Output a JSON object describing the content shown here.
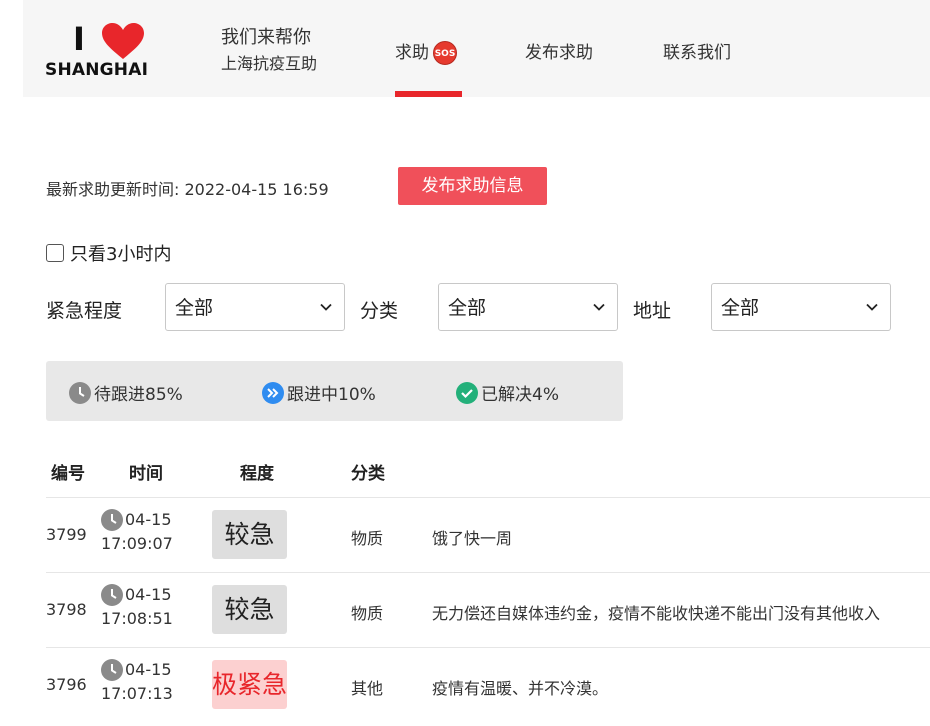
{
  "header": {
    "logo_i": "I",
    "logo_city": "SHANGHAI",
    "brand_title": "我们来帮你",
    "brand_subtitle": "上海抗疫互助",
    "nav": {
      "help": "求助",
      "sos_badge": "SOS",
      "post": "发布求助",
      "contact": "联系我们"
    },
    "accent_color": "#e8262b"
  },
  "update": {
    "label": "最新求助更新时间: 2022-04-15 16:59",
    "post_button": "发布求助信息"
  },
  "filters": {
    "recent_only_label": "只看3小时内",
    "recent_only_checked": false,
    "urgency_label": "紧急程度",
    "urgency_value": "全部",
    "category_label": "分类",
    "category_value": "全部",
    "address_label": "地址",
    "address_value": "全部"
  },
  "stats": {
    "pending": "待跟进85%",
    "following": "跟进中10%",
    "resolved": "已解决4%"
  },
  "table": {
    "headers": {
      "id": "编号",
      "time": "时间",
      "level": "程度",
      "category": "分类"
    },
    "rows": [
      {
        "id": "3799",
        "date": "04-15",
        "time": "17:09:07",
        "level": "较急",
        "level_type": "normal",
        "category": "物质",
        "desc": "饿了快一周"
      },
      {
        "id": "3798",
        "date": "04-15",
        "time": "17:08:51",
        "level": "较急",
        "level_type": "normal",
        "category": "物质",
        "desc": "无力偿还自媒体违约金，疫情不能收快递不能出门没有其他收入"
      },
      {
        "id": "3796",
        "date": "04-15",
        "time": "17:07:13",
        "level": "极紧急",
        "level_type": "urgent",
        "category": "其他",
        "desc": "疫情有温暖、并不冷漠。"
      }
    ]
  }
}
